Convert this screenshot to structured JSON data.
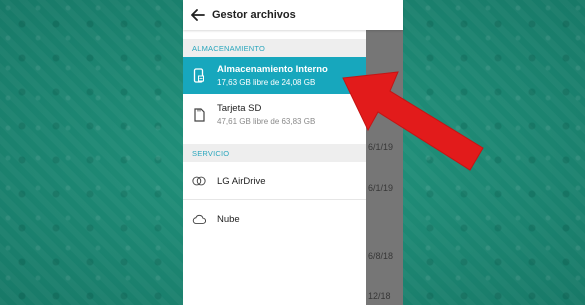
{
  "app_bar": {
    "title": "Gestor archivos"
  },
  "sections": {
    "storage_header": "ALMACENAMIENTO",
    "service_header": "SERVICIO"
  },
  "storage_items": [
    {
      "label": "Almacenamiento Interno",
      "detail": "17,63 GB libre de 24,08 GB"
    },
    {
      "label": "Tarjeta SD",
      "detail": "47,61 GB libre de 63,83 GB"
    }
  ],
  "service_items": [
    {
      "label": "LG AirDrive"
    },
    {
      "label": "Nube"
    }
  ],
  "background_dates": [
    "6/1/19",
    "6/1/19",
    "6/8/18",
    "12/18"
  ],
  "colors": {
    "accent": "#17a7bd",
    "wallpaper": "#1f8a77",
    "annotation_arrow": "#e21b1b"
  },
  "icons": {
    "back": "arrow-left-icon",
    "internal_storage": "phone-storage-icon",
    "sd_card": "sd-card-icon",
    "airdrive": "airdrive-icon",
    "cloud": "cloud-icon"
  }
}
